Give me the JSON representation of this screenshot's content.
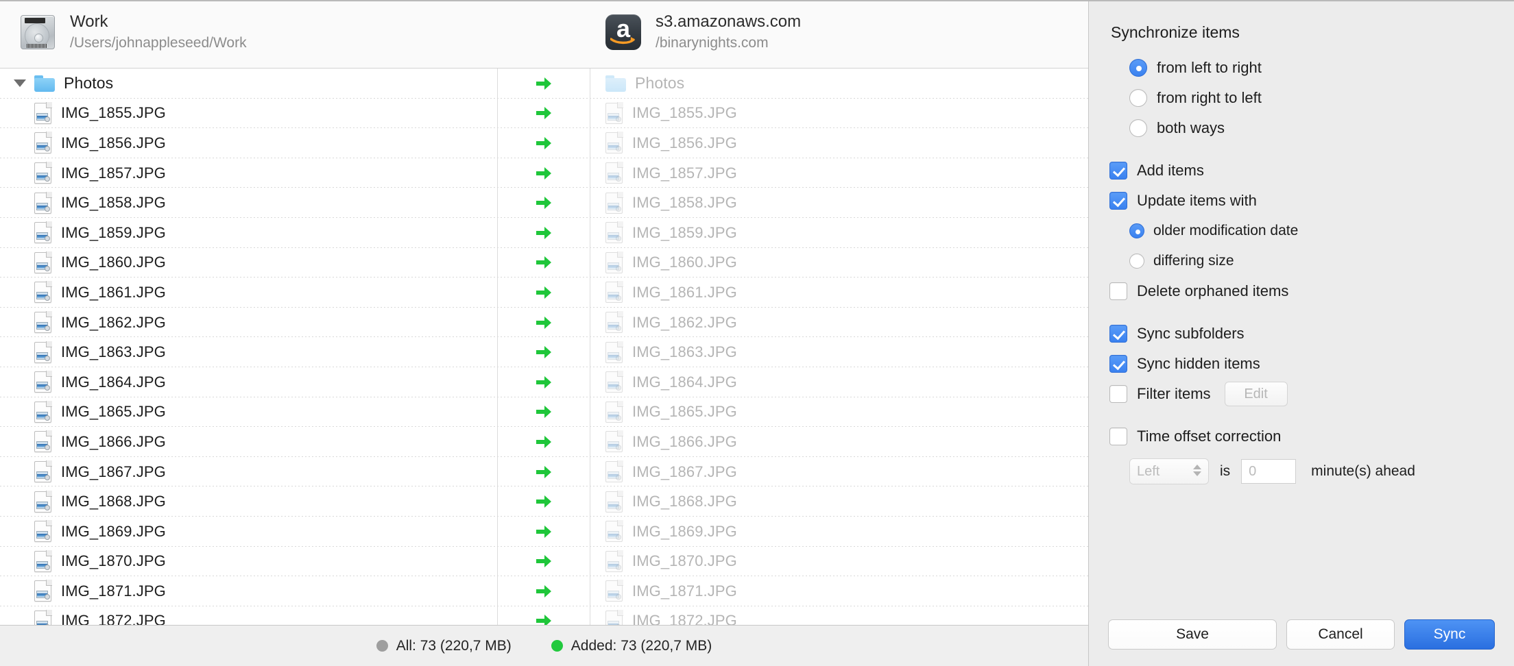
{
  "sources": {
    "left": {
      "icon": "hard-drive-icon",
      "title": "Work",
      "path": "/Users/johnappleseed/Work"
    },
    "right": {
      "icon": "amazon-s3-icon",
      "title": "s3.amazonaws.com",
      "path": "/binarynights.com"
    }
  },
  "list": {
    "arrow_icon": "green-right-arrow-icon",
    "rows": [
      {
        "type": "folder",
        "name": "Photos",
        "expanded": true,
        "action": "copy-right"
      },
      {
        "type": "file",
        "name": "IMG_1855.JPG",
        "action": "copy-right"
      },
      {
        "type": "file",
        "name": "IMG_1856.JPG",
        "action": "copy-right"
      },
      {
        "type": "file",
        "name": "IMG_1857.JPG",
        "action": "copy-right"
      },
      {
        "type": "file",
        "name": "IMG_1858.JPG",
        "action": "copy-right"
      },
      {
        "type": "file",
        "name": "IMG_1859.JPG",
        "action": "copy-right"
      },
      {
        "type": "file",
        "name": "IMG_1860.JPG",
        "action": "copy-right"
      },
      {
        "type": "file",
        "name": "IMG_1861.JPG",
        "action": "copy-right"
      },
      {
        "type": "file",
        "name": "IMG_1862.JPG",
        "action": "copy-right"
      },
      {
        "type": "file",
        "name": "IMG_1863.JPG",
        "action": "copy-right"
      },
      {
        "type": "file",
        "name": "IMG_1864.JPG",
        "action": "copy-right"
      },
      {
        "type": "file",
        "name": "IMG_1865.JPG",
        "action": "copy-right"
      },
      {
        "type": "file",
        "name": "IMG_1866.JPG",
        "action": "copy-right"
      },
      {
        "type": "file",
        "name": "IMG_1867.JPG",
        "action": "copy-right"
      },
      {
        "type": "file",
        "name": "IMG_1868.JPG",
        "action": "copy-right"
      },
      {
        "type": "file",
        "name": "IMG_1869.JPG",
        "action": "copy-right"
      },
      {
        "type": "file",
        "name": "IMG_1870.JPG",
        "action": "copy-right"
      },
      {
        "type": "file",
        "name": "IMG_1871.JPG",
        "action": "copy-right"
      },
      {
        "type": "file",
        "name": "IMG_1872.JPG",
        "action": "copy-right"
      }
    ]
  },
  "statusbar": {
    "all": {
      "label": "All: 73 (220,7 MB)",
      "color": "#9e9e9e"
    },
    "added": {
      "label": "Added: 73 (220,7 MB)",
      "color": "#22c93e"
    }
  },
  "inspector": {
    "section_title": "Synchronize items",
    "direction": {
      "options": [
        {
          "label": "from left to right",
          "selected": true
        },
        {
          "label": "from right to left",
          "selected": false
        },
        {
          "label": "both ways",
          "selected": false
        }
      ]
    },
    "add_items": {
      "label": "Add items",
      "checked": true
    },
    "update_items": {
      "label": "Update items with",
      "checked": true
    },
    "update_mode": {
      "options": [
        {
          "label": "older modification date",
          "selected": true
        },
        {
          "label": "differing size",
          "selected": false
        }
      ]
    },
    "delete_orphaned": {
      "label": "Delete orphaned items",
      "checked": false
    },
    "sync_subfolders": {
      "label": "Sync subfolders",
      "checked": true
    },
    "sync_hidden": {
      "label": "Sync hidden items",
      "checked": true
    },
    "filter_items": {
      "label": "Filter items",
      "checked": false,
      "edit_label": "Edit"
    },
    "time_offset": {
      "label": "Time offset correction",
      "checked": false,
      "side_value": "Left",
      "is_word": "is",
      "minutes_value": "0",
      "unit_label": "minute(s) ahead"
    },
    "buttons": {
      "save": "Save",
      "cancel": "Cancel",
      "sync": "Sync"
    },
    "accent": "#3a81ef"
  }
}
